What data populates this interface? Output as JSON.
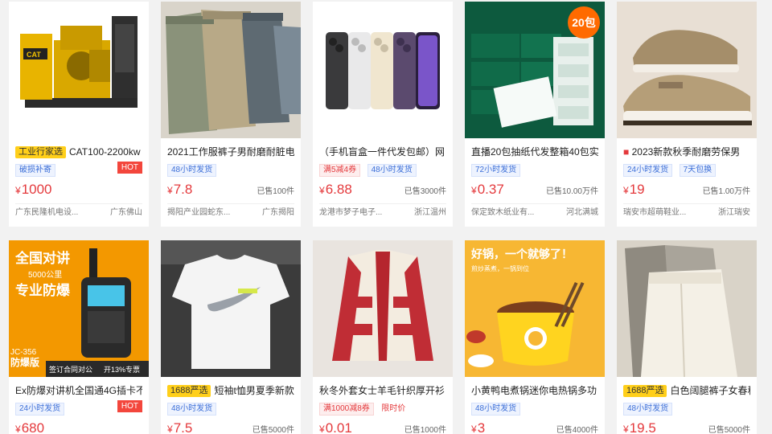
{
  "products": [
    {
      "badge": "工业行家选",
      "title": "CAT100-2200kw",
      "tags": [
        "破损补寄"
      ],
      "hot": "HOT",
      "price": "1000",
      "sold": "",
      "shop": "广东民隆机电设...",
      "location": "广东佛山"
    },
    {
      "badge": "",
      "title": "2021工作服裤子男耐磨耐脏电",
      "tags": [
        "48小时发货"
      ],
      "hot": "",
      "price": "7.8",
      "sold": "已售100件",
      "shop": "揭阳产业园蛇东...",
      "location": "广东揭阳"
    },
    {
      "badge": "",
      "title": "（手机盲盒一件代发包邮）网",
      "tags": [
        "满5减4券",
        "48小时发货"
      ],
      "hot": "",
      "price": "6.88",
      "sold": "已售3000件",
      "shop": "龙港市梦子电子...",
      "location": "浙江温州"
    },
    {
      "badge": "",
      "title": "直播20包抽纸代发整箱40包实",
      "tags": [
        "72小时发货"
      ],
      "hot": "",
      "price": "0.37",
      "sold": "已售10.00万件",
      "shop": "保定致木纸业有...",
      "location": "河北满城",
      "image_badge": "20包"
    },
    {
      "badge": "",
      "title": "2023新款秋季耐磨劳保男",
      "tags": [
        "24小时发货",
        "7天包换"
      ],
      "hot": "",
      "price": "19",
      "sold": "已售1.00万件",
      "shop": "瑞安市超萌鞋业...",
      "location": "浙江瑞安"
    },
    {
      "badge": "",
      "title": "Ex防爆对讲机全国通4G插卡不",
      "tags": [
        "24小时发货"
      ],
      "hot": "HOT",
      "price": "680",
      "sold": "",
      "shop": "",
      "location": "",
      "image_text": [
        "全国对讲",
        "5000公里",
        "专业防爆",
        "JC-356",
        "防爆版",
        "签订合同对公",
        "开13%专票"
      ]
    },
    {
      "badge": "1688严选",
      "title": "短袖t恤男夏季新款",
      "tags": [
        "48小时发货"
      ],
      "hot": "",
      "price": "7.5",
      "sold": "已售5000件",
      "shop": "",
      "location": ""
    },
    {
      "badge": "",
      "title": "秋冬外套女士羊毛针织厚开衫",
      "tags": [
        "满1000减8券",
        "限时价"
      ],
      "hot": "",
      "price": "0.01",
      "sold": "已售1000件",
      "shop": "",
      "location": ""
    },
    {
      "badge": "",
      "title": "小黄鸭电煮锅迷你电热锅多功",
      "tags": [
        "48小时发货"
      ],
      "hot": "",
      "price": "3",
      "sold": "已售4000件",
      "shop": "",
      "location": "",
      "image_text": [
        "好锅，一个就够了！",
        "煎炒蒸煮，一锅到位"
      ]
    },
    {
      "badge": "1688严选",
      "title": "白色阔腿裤子女春秋",
      "tags": [
        "48小时发货"
      ],
      "hot": "",
      "price": "19.5",
      "sold": "已售5000件",
      "shop": "",
      "location": ""
    }
  ],
  "currency": "¥"
}
